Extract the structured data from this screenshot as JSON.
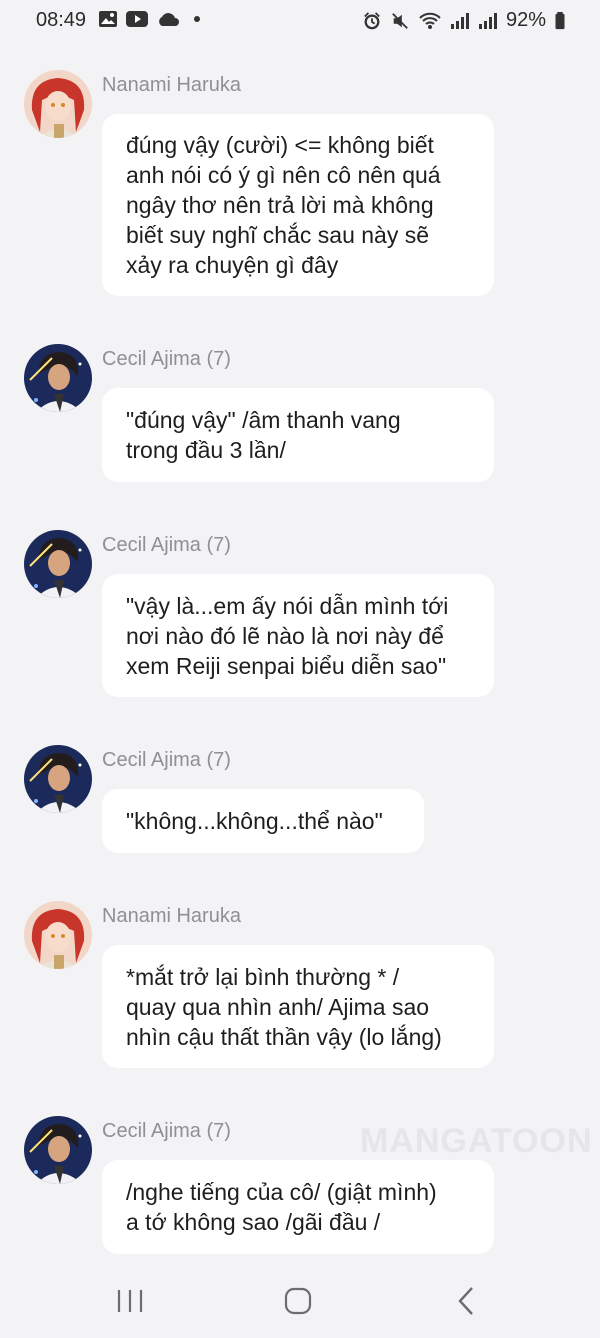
{
  "status_bar": {
    "time": "08:49",
    "battery": "92%",
    "left_icons": [
      "image-icon",
      "youtube-icon",
      "cloud-icon",
      "dot-icon"
    ],
    "right_icons": [
      "alarm-icon",
      "mute-icon",
      "wifi-icon",
      "signal-icon",
      "signal-icon",
      "battery-icon"
    ]
  },
  "messages": [
    {
      "sender": "Nanami Haruka",
      "avatar": "nanami-avatar",
      "lines": [
        "đúng vậy (cười) <= không biết",
        "anh nói có ý gì nên cô nên quá",
        "ngây thơ nên trả lời mà không",
        "biết suy nghĩ chắc sau này sẽ",
        "xảy ra chuyện gì đây"
      ]
    },
    {
      "sender": "Cecil Ajima (7)",
      "avatar": "cecil-avatar",
      "lines": [
        "\"đúng vậy\" /âm thanh vang",
        "trong đầu 3 lần/"
      ]
    },
    {
      "sender": "Cecil Ajima (7)",
      "avatar": "cecil-avatar",
      "lines": [
        "\"vậy là...em ấy nói dẫn mình tới",
        "nơi nào đó lẽ nào là nơi này để",
        "xem Reiji senpai biểu diễn sao\""
      ]
    },
    {
      "sender": "Cecil Ajima (7)",
      "avatar": "cecil-avatar",
      "lines": [
        "\"không...không...thể nào\""
      ]
    },
    {
      "sender": "Nanami Haruka",
      "avatar": "nanami-avatar",
      "lines": [
        "*mắt trở lại bình thường * /",
        "quay qua nhìn anh/ Ajima sao",
        "nhìn cậu thất thần vậy (lo lắng)"
      ]
    },
    {
      "sender": "Cecil Ajima (7)",
      "avatar": "cecil-avatar",
      "lines": [
        "/nghe tiếng của cô/ (giật mình)",
        "a tớ không sao /gãi đầu /"
      ]
    }
  ],
  "watermark": "MANGATOON",
  "nav_bar": {
    "buttons": [
      "recent-apps-button",
      "home-button",
      "back-button"
    ]
  }
}
